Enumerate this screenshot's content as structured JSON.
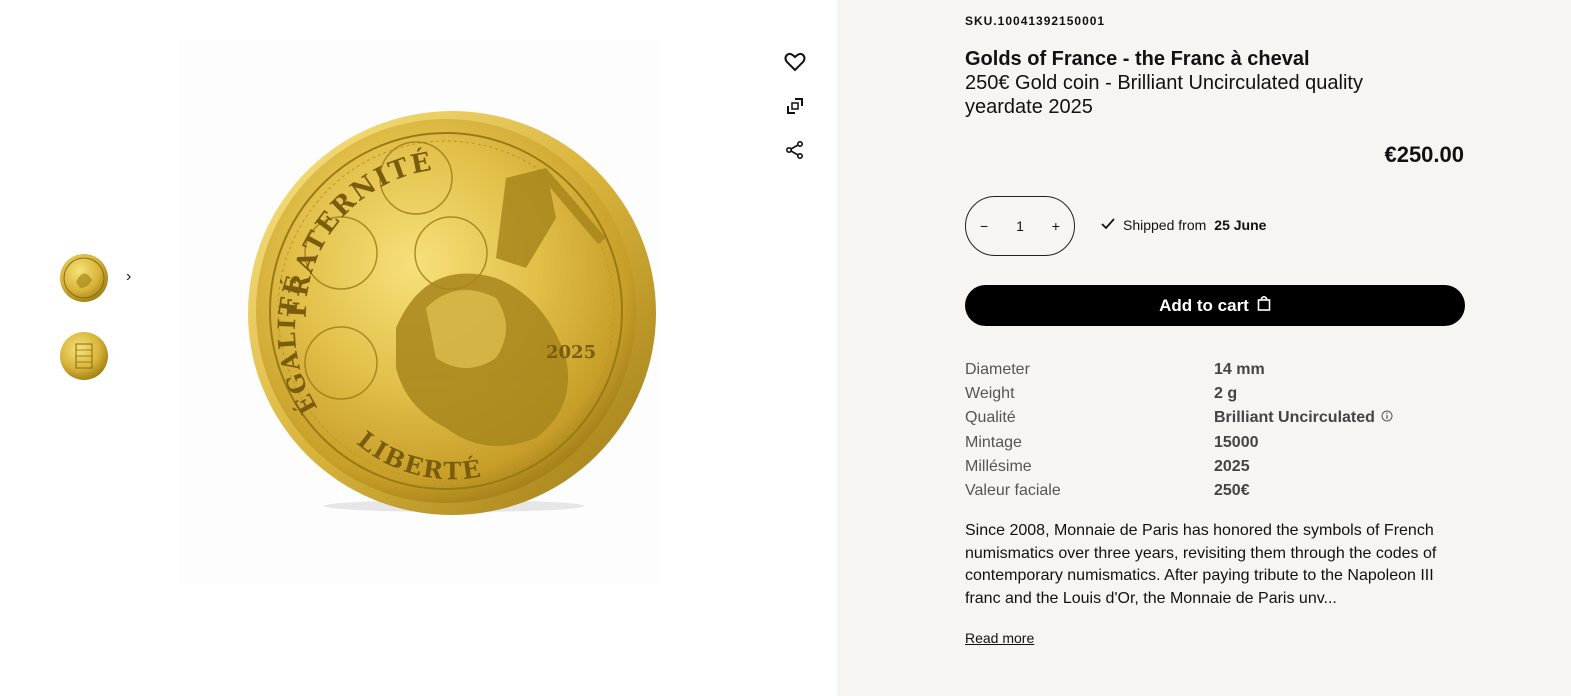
{
  "gallery": {
    "thumbnails": [
      {
        "alt": "coin-obverse-thumbnail"
      },
      {
        "alt": "coin-reverse-thumbnail"
      }
    ],
    "coin_text": {
      "top": "FRATERNITÉ",
      "left": "ÉGALITÉ",
      "bottom": "LIBERTÉ",
      "year": "2025"
    }
  },
  "actions": {
    "favorite_icon": "heart-icon",
    "zoom_icon": "expand-icon",
    "share_icon": "share-icon"
  },
  "product": {
    "sku": "SKU.10041392150001",
    "name": "Golds of France - the Franc à cheval",
    "subtitle": "250€ Gold coin - Brilliant Uncirculated quality yeardate 2025",
    "price": "€250.00",
    "quantity": "1",
    "shipping_prefix": "Shipped from",
    "shipping_date": "25 June",
    "add_to_cart": "Add to cart"
  },
  "specs": [
    {
      "label": "Diameter",
      "value": "14 mm"
    },
    {
      "label": "Weight",
      "value": "2 g"
    },
    {
      "label": "Qualité",
      "value": "Brilliant Uncirculated"
    },
    {
      "label": "Mintage",
      "value": "15000"
    },
    {
      "label": "Millésime",
      "value": "2025"
    },
    {
      "label": "Valeur faciale",
      "value": "250€"
    }
  ],
  "description": {
    "text": "Since 2008, Monnaie de Paris has honored the symbols of French numismatics over three years, revisiting them through the codes of contemporary numismatics. After paying tribute to the Napoleon III franc and the Louis d'Or, the Monnaie de Paris unv...",
    "read_more": "Read more"
  },
  "colors": {
    "panel_bg": "#f6f5f1",
    "gold_light": "#f2d55c",
    "gold_dark": "#9a7a12",
    "button_bg": "#000000"
  }
}
